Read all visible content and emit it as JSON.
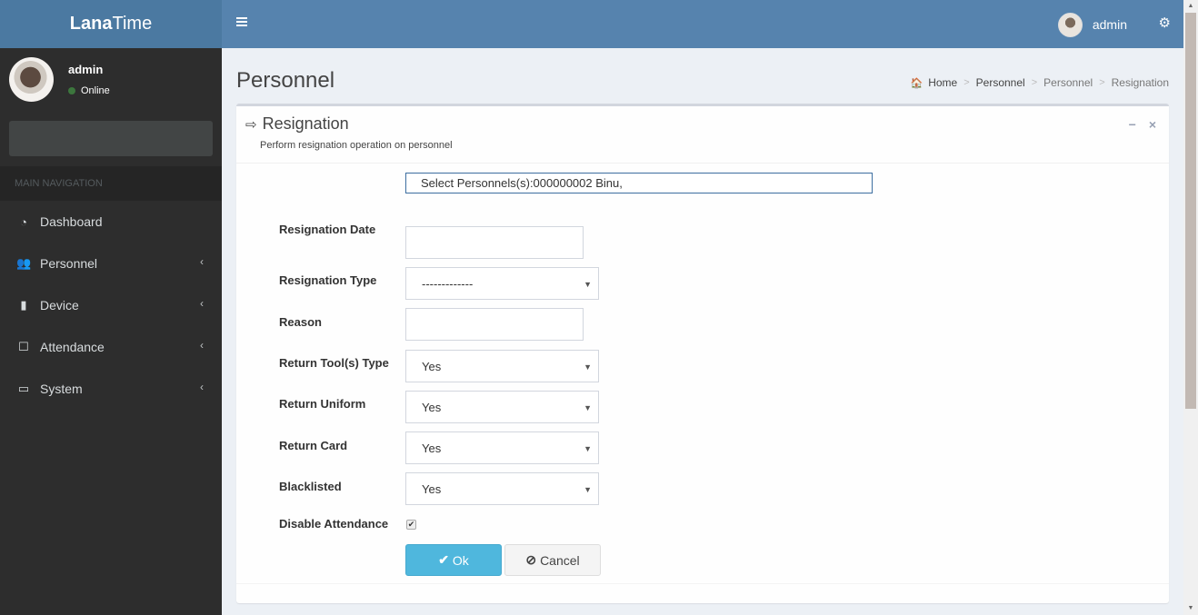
{
  "app": {
    "logo_bold": "Lana",
    "logo_regular": "Time"
  },
  "navbar": {
    "user_name": "admin",
    "menu_icon": "hamburger-icon",
    "settings_icon": "gears-icon"
  },
  "sidebar": {
    "user": {
      "name": "admin",
      "status": "Online",
      "status_color": "#3c763d"
    },
    "search_placeholder": "",
    "nav_header": "MAIN NAVIGATION",
    "items": [
      {
        "label": "Dashboard",
        "icon": "dashboard-icon",
        "glyph": "◔",
        "has_children": false
      },
      {
        "label": "Personnel",
        "icon": "users-icon",
        "glyph": "👥",
        "has_children": true
      },
      {
        "label": "Device",
        "icon": "device-icon",
        "glyph": "▮",
        "has_children": true
      },
      {
        "label": "Attendance",
        "icon": "sticky-note-icon",
        "glyph": "☐",
        "has_children": true
      },
      {
        "label": "System",
        "icon": "laptop-icon",
        "glyph": "▭",
        "has_children": true
      }
    ],
    "chevron": "‹"
  },
  "page": {
    "title": "Personnel",
    "breadcrumb": [
      {
        "label": "Home",
        "icon": "home-icon"
      },
      {
        "label": "Personnel"
      },
      {
        "label": "Personnel"
      },
      {
        "label": "Resignation"
      }
    ],
    "breadcrumb_separator": ">"
  },
  "box": {
    "title": "Resignation",
    "subtitle": "Perform resignation operation on personnel",
    "tools": {
      "collapse": "−",
      "remove": "×"
    }
  },
  "form": {
    "select_personnel": "Select Personnels(s):000000002 Binu,",
    "fields": {
      "resignation_date": {
        "label": "Resignation Date",
        "value": ""
      },
      "resignation_type": {
        "label": "Resignation Type",
        "value": "-------------"
      },
      "reason": {
        "label": "Reason",
        "value": ""
      },
      "return_tools": {
        "label": "Return Tool(s) Type",
        "value": "Yes"
      },
      "return_uniform": {
        "label": "Return Uniform",
        "value": "Yes"
      },
      "return_card": {
        "label": "Return Card",
        "value": "Yes"
      },
      "blacklisted": {
        "label": "Blacklisted",
        "value": "Yes"
      },
      "disable_attendance": {
        "label": "Disable Attendance",
        "checked": true
      }
    },
    "buttons": {
      "ok": "Ok",
      "cancel": "Cancel"
    }
  },
  "colors": {
    "header": "#5683ae",
    "logo_bg": "#4b79a1",
    "sidebar_bg": "#2d2d2d",
    "ok_button": "#4fb7dd"
  }
}
